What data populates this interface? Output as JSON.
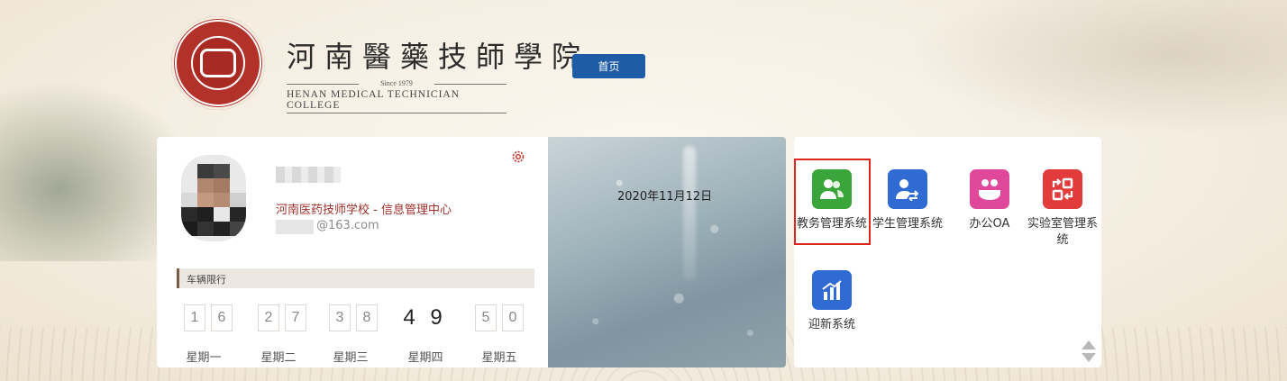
{
  "header": {
    "logo_alt": "河南医药技师学院 校徽",
    "logo_cn": "河南醫藥技師學院",
    "logo_since": "Since 1979",
    "logo_en": "HENAN MEDICAL TECHNICIAN COLLEGE",
    "nav_home": "首页"
  },
  "user": {
    "org": "河南医药技师学校 - 信息管理中心",
    "email_suffix": "@163.com",
    "settings_icon": "gear-icon"
  },
  "traffic_restriction": {
    "title": "车辆限行",
    "days": [
      {
        "label": "星期一",
        "digits": [
          "1",
          "6"
        ],
        "today": false
      },
      {
        "label": "星期二",
        "digits": [
          "2",
          "7"
        ],
        "today": false
      },
      {
        "label": "星期三",
        "digits": [
          "3",
          "8"
        ],
        "today": false
      },
      {
        "label": "星期四",
        "digits": [
          "4",
          "9"
        ],
        "today": true
      },
      {
        "label": "星期五",
        "digits": [
          "5",
          "0"
        ],
        "today": false
      }
    ]
  },
  "weather": {
    "date": "2020年11月12日"
  },
  "apps": [
    {
      "label": "教务管理系统",
      "color": "#3aa53a",
      "icon": "users-icon",
      "selected": true
    },
    {
      "label": "学生管理系统",
      "color": "#2f6bd2",
      "icon": "user-exchange-icon",
      "selected": false
    },
    {
      "label": "办公OA",
      "color": "#e0489b",
      "icon": "meeting-icon",
      "selected": false
    },
    {
      "label": "实验室管理系统",
      "color": "#e23b3b",
      "icon": "lab-swap-icon",
      "selected": false
    },
    {
      "label": "迎新系统",
      "color": "#2f6bd2",
      "icon": "bar-chart-icon",
      "selected": false
    }
  ],
  "colors": {
    "accent_blue": "#1f5ca6",
    "org_red": "#a0302b",
    "highlight_red": "#e0261c"
  }
}
